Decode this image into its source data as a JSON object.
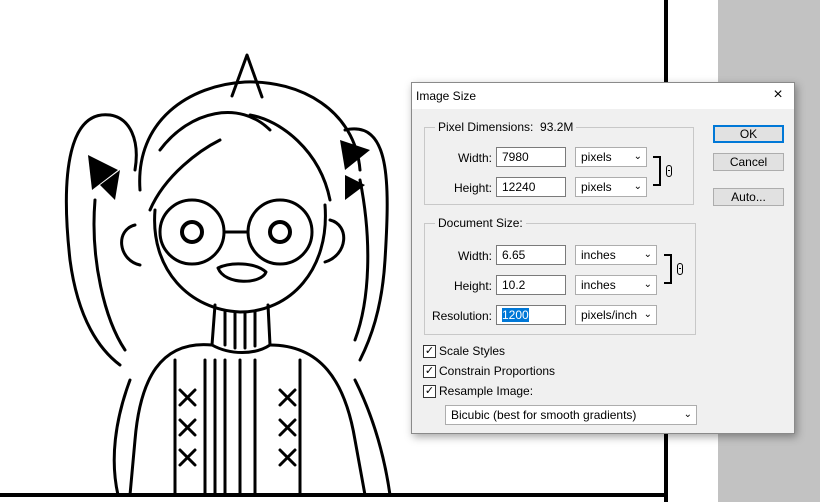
{
  "dialog": {
    "title": "Image Size",
    "close_glyph": "×",
    "pixel_dimensions": {
      "label": "Pixel Dimensions:",
      "size": "93.2M",
      "width_label": "Width:",
      "width_value": "7980",
      "width_unit": "pixels",
      "height_label": "Height:",
      "height_value": "12240",
      "height_unit": "pixels"
    },
    "document_size": {
      "label": "Document Size:",
      "width_label": "Width:",
      "width_value": "6.65",
      "width_unit": "inches",
      "height_label": "Height:",
      "height_value": "10.2",
      "height_unit": "inches",
      "resolution_label": "Resolution:",
      "resolution_value": "1200",
      "resolution_unit": "pixels/inch"
    },
    "checkboxes": {
      "scale_styles": {
        "label": "Scale Styles",
        "checked": true
      },
      "constrain_proportions": {
        "label": "Constrain Proportions",
        "checked": true
      },
      "resample_image": {
        "label": "Resample Image:",
        "checked": true
      }
    },
    "resample_method": "Bicubic (best for smooth gradients)",
    "buttons": {
      "ok": "OK",
      "cancel": "Cancel",
      "auto": "Auto..."
    },
    "check_glyph": "✓",
    "chevron_glyph": "⌄"
  }
}
